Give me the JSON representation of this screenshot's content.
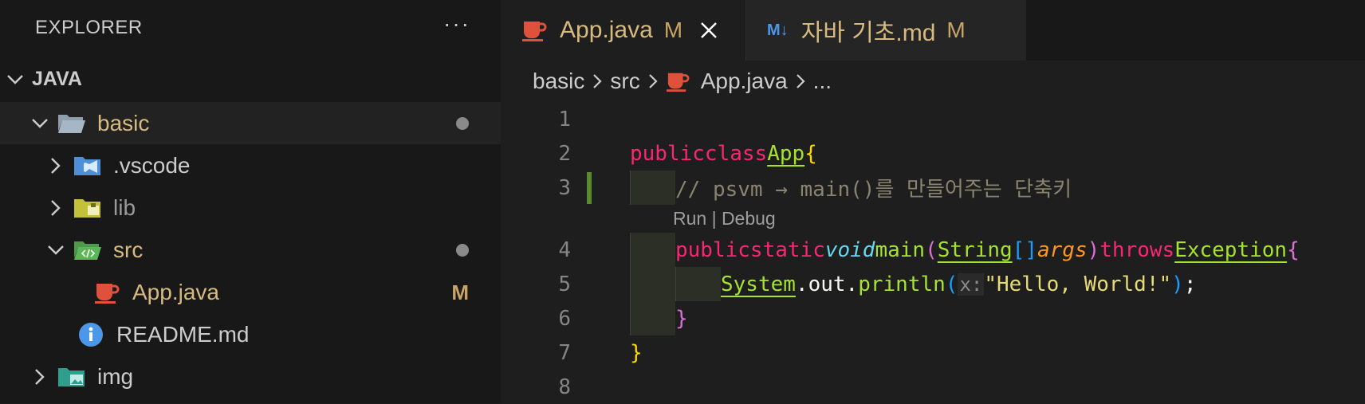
{
  "sidebar": {
    "title": "EXPLORER",
    "more": "···",
    "section": "JAVA",
    "tree": [
      {
        "label": "basic",
        "indicator": "dot"
      },
      {
        "label": ".vscode"
      },
      {
        "label": "lib"
      },
      {
        "label": "src",
        "indicator": "dot"
      },
      {
        "label": "App.java",
        "badge": "M"
      },
      {
        "label": "README.md"
      },
      {
        "label": "img"
      }
    ]
  },
  "tabs": [
    {
      "label": "App.java",
      "badge": "M",
      "active": true
    },
    {
      "icon_text": "M↓",
      "label": "자바 기초.md",
      "badge": "M",
      "active": false
    }
  ],
  "breadcrumb": [
    "basic",
    "src",
    "App.java",
    "..."
  ],
  "editor": {
    "line_numbers": [
      "1",
      "2",
      "3",
      "4",
      "5",
      "6",
      "7",
      "8"
    ],
    "codelens": "Run | Debug",
    "tokens": {
      "public": "public",
      "class": "class",
      "app": "App",
      "brace_open": "{",
      "comment": "// psvm → main()를 만들어주는 단축키",
      "static": "static",
      "void": "void",
      "main": "main",
      "paren_open": "(",
      "string_type": "String",
      "brackets": "[]",
      "args": "args",
      "paren_close": ")",
      "throws": "throws",
      "exception": "Exception",
      "system": "System",
      "dot_out": ".out.",
      "println": "println",
      "hint": "x:",
      "hello": "\"Hello, World!\"",
      "semicolon": ";",
      "brace_close": "}"
    }
  },
  "colors": {
    "modified": "#d7ba7d",
    "java_icon": "#e0513b",
    "keyword": "#f92672",
    "function": "#a6e22e",
    "string": "#e6db74",
    "comment": "#88846f"
  }
}
